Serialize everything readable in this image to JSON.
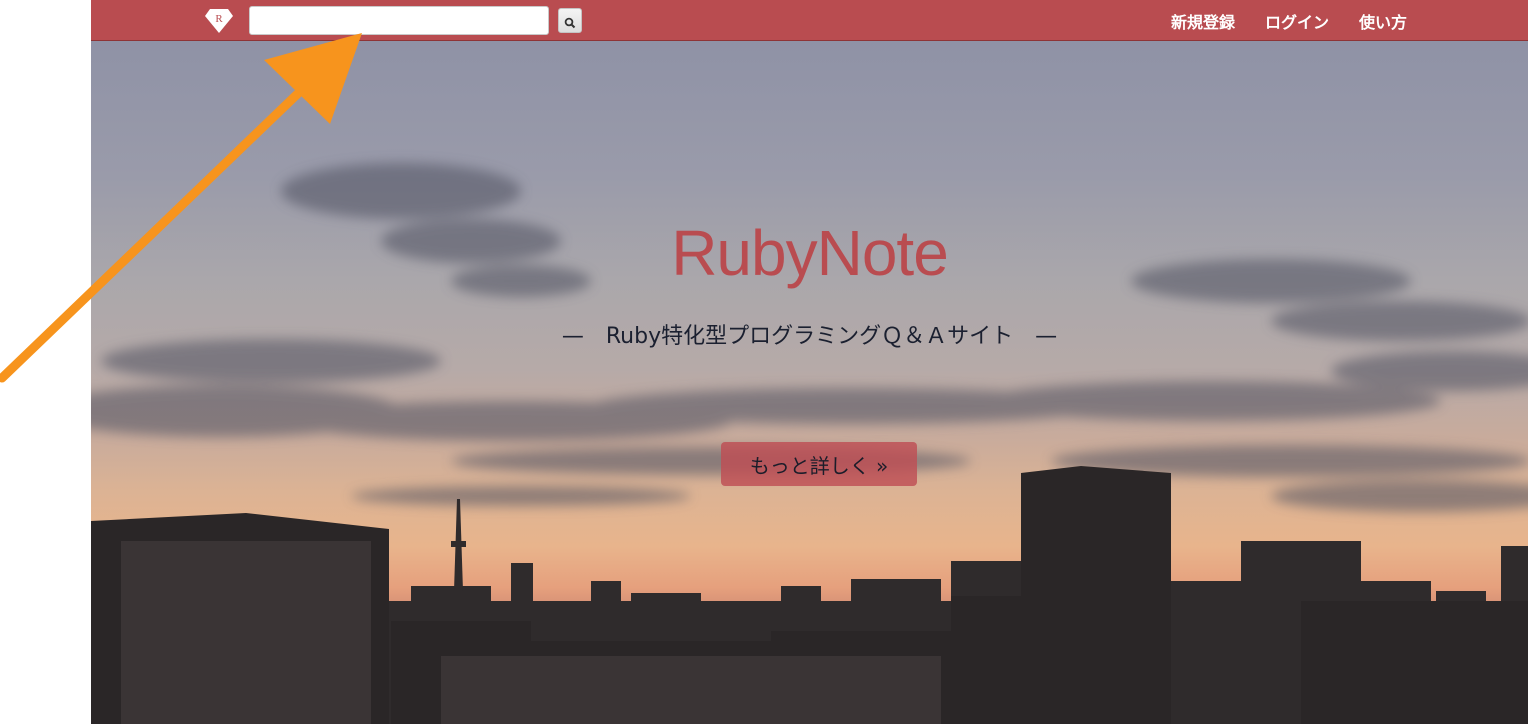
{
  "navbar": {
    "logo_letter": "R",
    "search": {
      "value": "",
      "placeholder": ""
    },
    "search_icon": "magnifier-icon",
    "links": [
      {
        "label": "新規登録"
      },
      {
        "label": "ログイン"
      },
      {
        "label": "使い方"
      }
    ],
    "brand_color": "#b94c50"
  },
  "hero": {
    "title": "RubyNote",
    "tagline": "—　Ruby特化型プログラミングＱ＆Ａサイト　—",
    "more_button": "もっと詳しく »"
  },
  "annotation": {
    "arrow_color": "#f7941d",
    "points_to": "search-input"
  }
}
